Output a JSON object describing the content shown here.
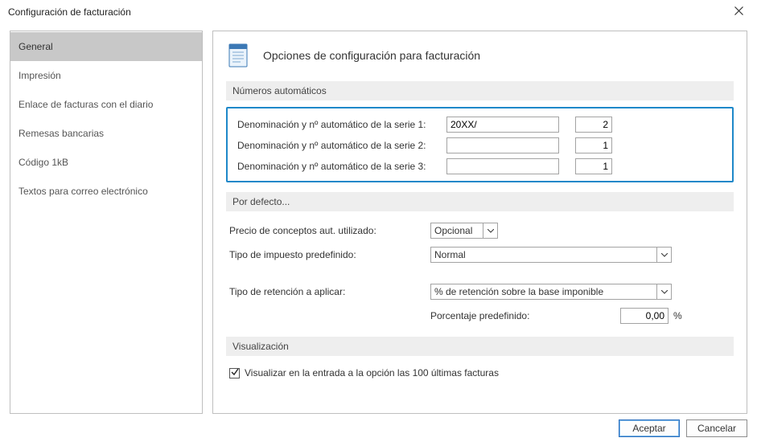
{
  "window": {
    "title": "Configuración de facturación"
  },
  "sidebar": {
    "items": [
      {
        "label": "General",
        "selected": true
      },
      {
        "label": "Impresión",
        "selected": false
      },
      {
        "label": "Enlace de facturas con el diario",
        "selected": false
      },
      {
        "label": "Remesas bancarias",
        "selected": false
      },
      {
        "label": "Código 1kB",
        "selected": false
      },
      {
        "label": "Textos para correo electrónico",
        "selected": false
      }
    ]
  },
  "main": {
    "header": {
      "title": "Opciones de configuración para facturación"
    },
    "sections": {
      "auto_numbers": {
        "title": "Números automáticos",
        "rows": [
          {
            "label": "Denominación y nº automático de la serie 1:",
            "text": "20XX/",
            "num": "2"
          },
          {
            "label": "Denominación y nº automático de la serie 2:",
            "text": "",
            "num": "1"
          },
          {
            "label": "Denominación y nº automático de la serie 3:",
            "text": "",
            "num": "1"
          }
        ]
      },
      "defaults": {
        "title": "Por defecto...",
        "price_label": "Precio de conceptos aut. utilizado:",
        "price_value": "Opcional",
        "tax_label": "Tipo de impuesto predefinido:",
        "tax_value": "Normal",
        "ret_label": "Tipo de retención a aplicar:",
        "ret_value": "% de retención sobre la base imponible",
        "pct_label": "Porcentaje predefinido:",
        "pct_value": "0,00",
        "pct_suffix": "%"
      },
      "visual": {
        "title": "Visualización",
        "checkbox_label": "Visualizar en la entrada a la opción las 100 últimas facturas",
        "checked": true
      }
    }
  },
  "footer": {
    "accept": "Aceptar",
    "cancel": "Cancelar"
  }
}
